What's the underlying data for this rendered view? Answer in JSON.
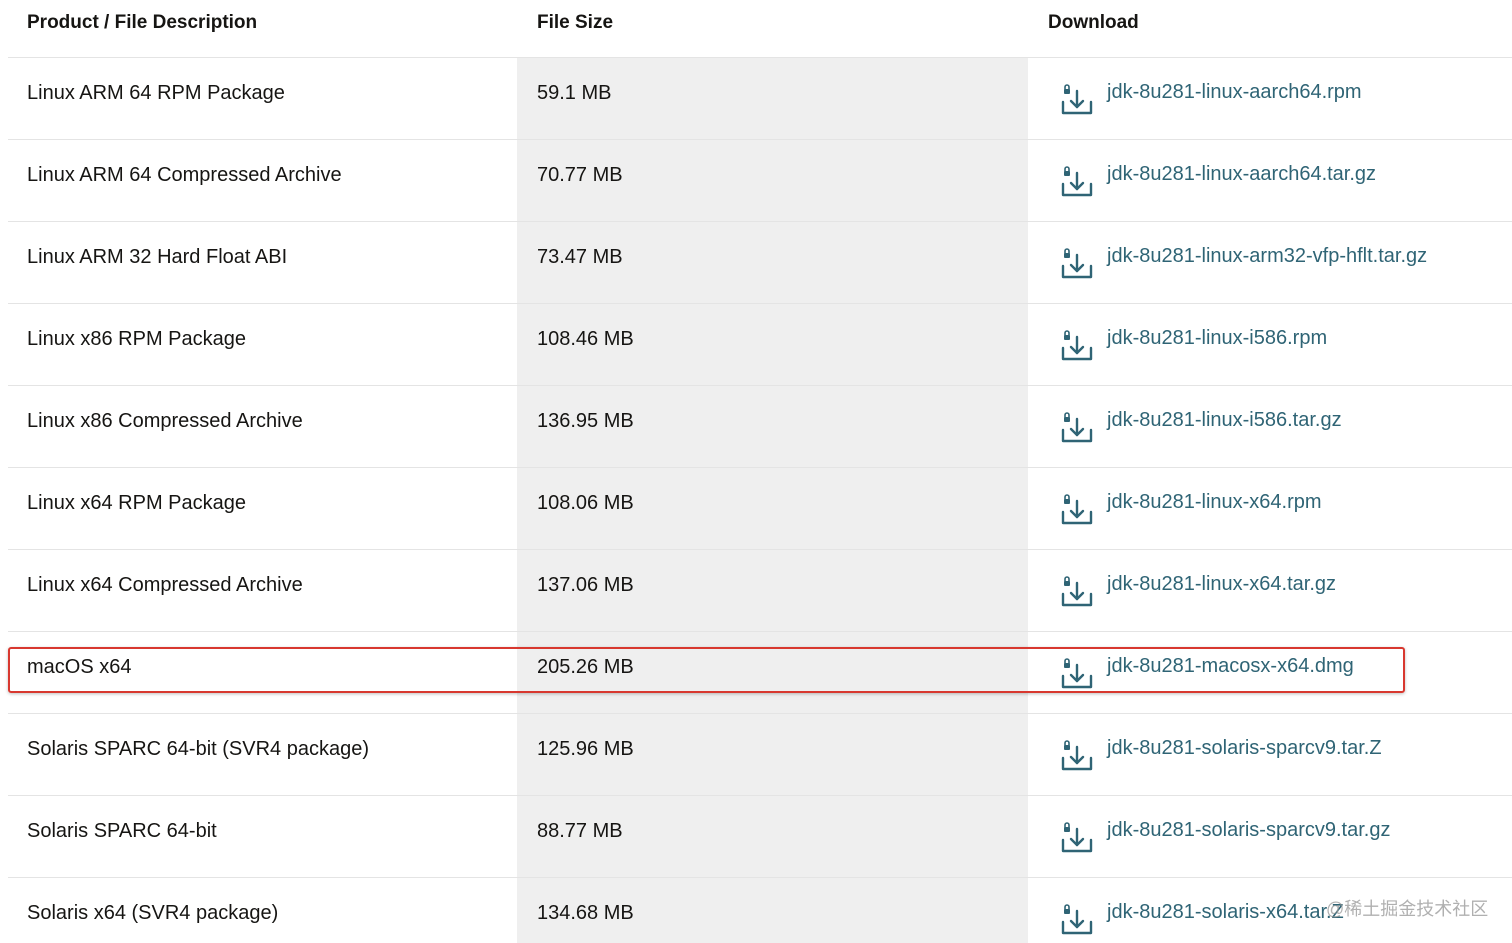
{
  "table": {
    "headers": {
      "description": "Product / File Description",
      "size": "File Size",
      "download": "Download"
    },
    "rows": [
      {
        "description": "Linux ARM 64 RPM Package",
        "size": "59.1 MB",
        "file": "jdk-8u281-linux-aarch64.rpm"
      },
      {
        "description": "Linux ARM 64 Compressed Archive",
        "size": "70.77 MB",
        "file": "jdk-8u281-linux-aarch64.tar.gz"
      },
      {
        "description": "Linux ARM 32 Hard Float ABI",
        "size": "73.47 MB",
        "file": "jdk-8u281-linux-arm32-vfp-hflt.tar.gz"
      },
      {
        "description": "Linux x86 RPM Package",
        "size": "108.46 MB",
        "file": "jdk-8u281-linux-i586.rpm"
      },
      {
        "description": "Linux x86 Compressed Archive",
        "size": "136.95 MB",
        "file": "jdk-8u281-linux-i586.tar.gz"
      },
      {
        "description": "Linux x64 RPM Package",
        "size": "108.06 MB",
        "file": "jdk-8u281-linux-x64.rpm"
      },
      {
        "description": "Linux x64 Compressed Archive",
        "size": "137.06 MB",
        "file": "jdk-8u281-linux-x64.tar.gz"
      },
      {
        "description": "macOS x64",
        "size": "205.26 MB",
        "file": "jdk-8u281-macosx-x64.dmg"
      },
      {
        "description": "Solaris SPARC 64-bit (SVR4 package)",
        "size": "125.96 MB",
        "file": "jdk-8u281-solaris-sparcv9.tar.Z"
      },
      {
        "description": "Solaris SPARC 64-bit",
        "size": "88.77 MB",
        "file": "jdk-8u281-solaris-sparcv9.tar.gz"
      },
      {
        "description": "Solaris x64 (SVR4 package)",
        "size": "134.68 MB",
        "file": "jdk-8u281-solaris-x64.tar.Z"
      }
    ]
  },
  "highlighted_row": "macOS x64",
  "watermark": "@稀土掘金技术社区",
  "icons": {
    "download": "download-icon"
  },
  "colors": {
    "link": "#2f6475",
    "highlight_border": "#d8382f",
    "size_column_bg": "#efefef"
  }
}
